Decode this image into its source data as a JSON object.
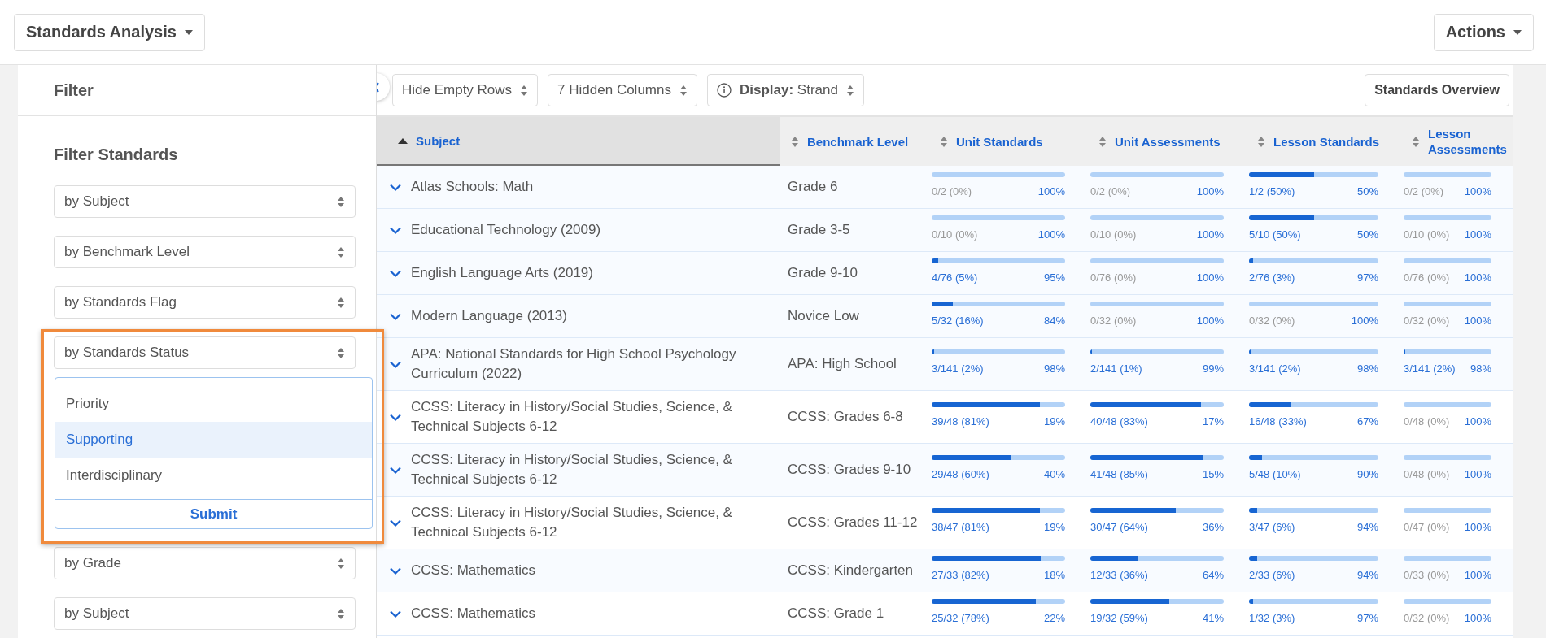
{
  "header": {
    "title": "Standards Analysis",
    "actions": "Actions"
  },
  "sidebar": {
    "title": "Filter",
    "standards_heading": "Filter Standards",
    "standards_filters": [
      "by Subject",
      "by Benchmark Level",
      "by Standards Flag",
      "by Standards Status"
    ],
    "status_options": [
      {
        "label": "Priority",
        "selected": false
      },
      {
        "label": "Supporting",
        "selected": true
      },
      {
        "label": "Interdisciplinary",
        "selected": false
      }
    ],
    "status_submit": "Submit",
    "course_filters": [
      "by Grade",
      "by Subject"
    ]
  },
  "toolbar": {
    "buttons": [
      {
        "kind": "select",
        "label": "Hide Empty Rows"
      },
      {
        "kind": "select",
        "label": "7 Hidden Columns"
      },
      {
        "kind": "info-select",
        "label": "**Display:** Strand"
      }
    ],
    "overview": "Standards Overview"
  },
  "table": {
    "columns": [
      {
        "label": "Subject",
        "selected": true
      },
      {
        "label": "Benchmark Level",
        "selected": false
      },
      {
        "label": "Unit Standards",
        "selected": false
      },
      {
        "label": "Unit Assessments",
        "selected": false
      },
      {
        "label": "Lesson Standards",
        "selected": false
      },
      {
        "label": "Lesson Assessments",
        "selected": false
      }
    ],
    "rows": [
      {
        "cells": [
          {
            "kind": "subject",
            "text": "Atlas Schools: Math"
          },
          {
            "kind": "text",
            "text": "Grade 6"
          },
          {
            "kind": "progress",
            "count": "0/2 (0%)",
            "remaining": "100%",
            "level": 0
          },
          {
            "kind": "progress",
            "count": "0/2 (0%)",
            "remaining": "100%",
            "level": 0
          },
          {
            "kind": "progress",
            "count": "1/2 (50%)",
            "remaining": "50%",
            "level": 0.5
          },
          {
            "kind": "progress",
            "count": "0/2 (0%)",
            "remaining": "100%",
            "level": 0
          }
        ]
      },
      {
        "cells": [
          {
            "kind": "subject",
            "text": "Educational Technology (2009)"
          },
          {
            "kind": "text",
            "text": "Grade 3-5"
          },
          {
            "kind": "progress",
            "count": "0/10 (0%)",
            "remaining": "100%",
            "level": 0
          },
          {
            "kind": "progress",
            "count": "0/10 (0%)",
            "remaining": "100%",
            "level": 0
          },
          {
            "kind": "progress",
            "count": "5/10 (50%)",
            "remaining": "50%",
            "level": 0.5
          },
          {
            "kind": "progress",
            "count": "0/10 (0%)",
            "remaining": "100%",
            "level": 0
          }
        ]
      },
      {
        "cells": [
          {
            "kind": "subject",
            "text": "English Language Arts (2019)"
          },
          {
            "kind": "text",
            "text": "Grade 9-10"
          },
          {
            "kind": "progress",
            "count": "4/76 (5%)",
            "remaining": "95%",
            "level": 0.05
          },
          {
            "kind": "progress",
            "count": "0/76 (0%)",
            "remaining": "100%",
            "level": 0
          },
          {
            "kind": "progress",
            "count": "2/76 (3%)",
            "remaining": "97%",
            "level": 0.03
          },
          {
            "kind": "progress",
            "count": "0/76 (0%)",
            "remaining": "100%",
            "level": 0
          }
        ]
      },
      {
        "cells": [
          {
            "kind": "subject",
            "text": "Modern Language (2013)"
          },
          {
            "kind": "text",
            "text": "Novice Low"
          },
          {
            "kind": "progress",
            "count": "5/32 (16%)",
            "remaining": "84%",
            "level": 0.16
          },
          {
            "kind": "progress",
            "count": "0/32 (0%)",
            "remaining": "100%",
            "level": 0
          },
          {
            "kind": "progress",
            "count": "0/32 (0%)",
            "remaining": "100%",
            "level": 0
          },
          {
            "kind": "progress",
            "count": "0/32 (0%)",
            "remaining": "100%",
            "level": 0
          }
        ]
      },
      {
        "cells": [
          {
            "kind": "subject",
            "text": "APA: National Standards for High School Psychology Curriculum (2022)"
          },
          {
            "kind": "text",
            "text": "APA: High School"
          },
          {
            "kind": "progress",
            "count": "3/141 (2%)",
            "remaining": "98%",
            "level": 0.02
          },
          {
            "kind": "progress",
            "count": "2/141 (1%)",
            "remaining": "99%",
            "level": 0.01
          },
          {
            "kind": "progress",
            "count": "3/141 (2%)",
            "remaining": "98%",
            "level": 0.02
          },
          {
            "kind": "progress",
            "count": "3/141 (2%)",
            "remaining": "98%",
            "level": 0.02
          }
        ]
      },
      {
        "cells": [
          {
            "kind": "subject",
            "text": "CCSS: Literacy in History/Social Studies, Science, & Technical Subjects 6-12"
          },
          {
            "kind": "text",
            "text": "CCSS: Grades 6-8"
          },
          {
            "kind": "progress",
            "count": "39/48 (81%)",
            "remaining": "19%",
            "level": 0.81
          },
          {
            "kind": "progress",
            "count": "40/48 (83%)",
            "remaining": "17%",
            "level": 0.83
          },
          {
            "kind": "progress",
            "count": "16/48 (33%)",
            "remaining": "67%",
            "level": 0.33
          },
          {
            "kind": "progress",
            "count": "0/48 (0%)",
            "remaining": "100%",
            "level": 0
          }
        ]
      },
      {
        "cells": [
          {
            "kind": "subject",
            "text": "CCSS: Literacy in History/Social Studies, Science, & Technical Subjects 6-12"
          },
          {
            "kind": "text",
            "text": "CCSS: Grades 9-10"
          },
          {
            "kind": "progress",
            "count": "29/48 (60%)",
            "remaining": "40%",
            "level": 0.6
          },
          {
            "kind": "progress",
            "count": "41/48 (85%)",
            "remaining": "15%",
            "level": 0.85
          },
          {
            "kind": "progress",
            "count": "5/48 (10%)",
            "remaining": "90%",
            "level": 0.1
          },
          {
            "kind": "progress",
            "count": "0/48 (0%)",
            "remaining": "100%",
            "level": 0
          }
        ]
      },
      {
        "cells": [
          {
            "kind": "subject",
            "text": "CCSS: Literacy in History/Social Studies, Science, & Technical Subjects 6-12"
          },
          {
            "kind": "text",
            "text": "CCSS: Grades 11-12"
          },
          {
            "kind": "progress",
            "count": "38/47 (81%)",
            "remaining": "19%",
            "level": 0.81
          },
          {
            "kind": "progress",
            "count": "30/47 (64%)",
            "remaining": "36%",
            "level": 0.64
          },
          {
            "kind": "progress",
            "count": "3/47 (6%)",
            "remaining": "94%",
            "level": 0.06
          },
          {
            "kind": "progress",
            "count": "0/47 (0%)",
            "remaining": "100%",
            "level": 0
          }
        ]
      },
      {
        "cells": [
          {
            "kind": "subject",
            "text": "CCSS: Mathematics"
          },
          {
            "kind": "text",
            "text": "CCSS: Kindergarten"
          },
          {
            "kind": "progress",
            "count": "27/33 (82%)",
            "remaining": "18%",
            "level": 0.82
          },
          {
            "kind": "progress",
            "count": "12/33 (36%)",
            "remaining": "64%",
            "level": 0.36
          },
          {
            "kind": "progress",
            "count": "2/33 (6%)",
            "remaining": "94%",
            "level": 0.06
          },
          {
            "kind": "progress",
            "count": "0/33 (0%)",
            "remaining": "100%",
            "level": 0
          }
        ]
      },
      {
        "cells": [
          {
            "kind": "subject",
            "text": "CCSS: Mathematics"
          },
          {
            "kind": "text",
            "text": "CCSS: Grade 1"
          },
          {
            "kind": "progress",
            "count": "25/32 (78%)",
            "remaining": "22%",
            "level": 0.78
          },
          {
            "kind": "progress",
            "count": "19/32 (59%)",
            "remaining": "41%",
            "level": 0.59
          },
          {
            "kind": "progress",
            "count": "1/32 (3%)",
            "remaining": "97%",
            "level": 0.03
          },
          {
            "kind": "progress",
            "count": "0/32 (0%)",
            "remaining": "100%",
            "level": 0
          }
        ]
      }
    ]
  }
}
